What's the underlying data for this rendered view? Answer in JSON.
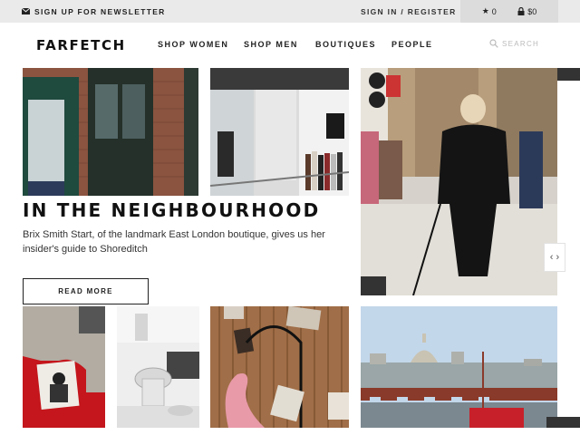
{
  "topbar": {
    "newsletter_icon": "envelope-icon",
    "newsletter_label": "SIGN UP FOR NEWSLETTER",
    "signin_label": "SIGN IN / REGISTER",
    "wishlist_icon": "star-icon",
    "wishlist_count": "0",
    "bag_icon": "lock-bag-icon",
    "bag_total": "$0"
  },
  "nav": {
    "logo": "FARFETCH",
    "links": [
      "SHOP WOMEN",
      "SHOP MEN",
      "BOUTIQUES",
      "PEOPLE"
    ],
    "search_icon": "search-icon",
    "search_label": "SEARCH"
  },
  "feature": {
    "headline": "IN THE NEIGHBOURHOOD",
    "description": "Brix Smith Start, of the landmark East London boutique, gives us her insider's guide to Shoreditch",
    "cta_label": "READ MORE",
    "arrow_label": "‹ ›"
  },
  "colors": {
    "topbar_bg": "#eaeaea",
    "cart_bg": "#dcdcdc",
    "text": "#222222",
    "search_text": "#bbbbbb"
  }
}
